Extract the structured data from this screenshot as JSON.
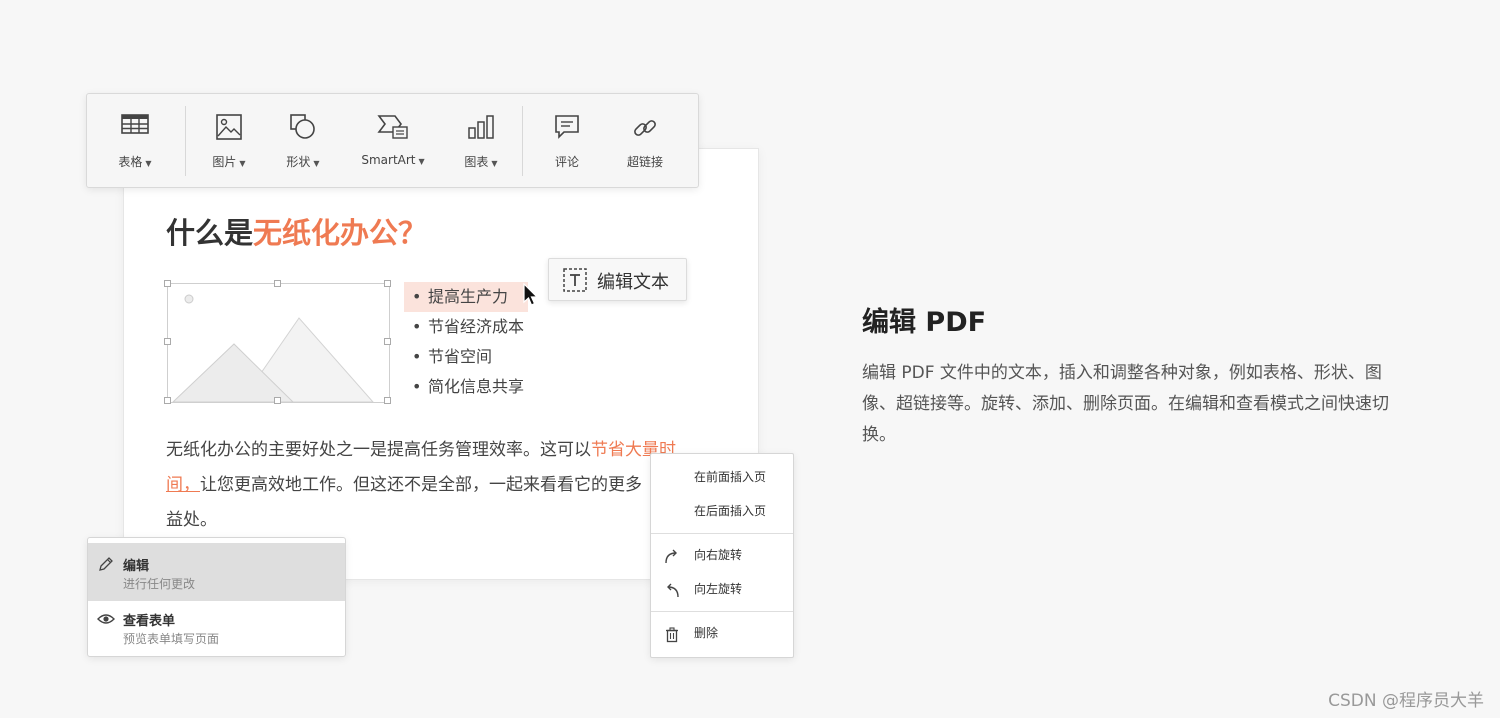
{
  "toolbar": {
    "items": [
      {
        "label": "表格",
        "has_dropdown": true,
        "icon": "table-icon"
      },
      {
        "label": "图片",
        "has_dropdown": true,
        "icon": "image-icon"
      },
      {
        "label": "形状",
        "has_dropdown": true,
        "icon": "shape-icon"
      },
      {
        "label": "SmartArt",
        "has_dropdown": true,
        "icon": "smartart-icon"
      },
      {
        "label": "图表",
        "has_dropdown": true,
        "icon": "chart-icon"
      },
      {
        "label": "评论",
        "has_dropdown": false,
        "icon": "comment-icon"
      },
      {
        "label": "超链接",
        "has_dropdown": false,
        "icon": "link-icon"
      }
    ]
  },
  "document": {
    "heading_prefix": "什么是",
    "heading_highlight": "无纸化办公？",
    "bullets": [
      "提高生产力",
      "节省经济成本",
      "节省空间",
      "简化信息共享"
    ],
    "edit_text_tooltip": "编辑文本",
    "paragraph": {
      "part1": "无纸化办公的主要好处之一是提高任务管理效率。这可以",
      "highlight1": "节省大量时",
      "highlight2": "间，",
      "part2": "让您更高效地工作。但这还不是全部，一起来看看它的更多",
      "part3": "益处。"
    }
  },
  "mode_menu": {
    "items": [
      {
        "title": "编辑",
        "subtitle": "进行任何更改",
        "icon": "pencil-icon",
        "selected": true
      },
      {
        "title": "查看表单",
        "subtitle": "预览表单填写页面",
        "icon": "eye-icon",
        "selected": false
      }
    ]
  },
  "context_menu": {
    "insert_before": "在前面插入页",
    "insert_after": "在后面插入页",
    "rotate_right": "向右旋转",
    "rotate_left": "向左旋转",
    "delete": "删除"
  },
  "feature": {
    "title": "编辑 PDF",
    "description": "编辑 PDF 文件中的文本，插入和调整各种对象，例如表格、形状、图像、超链接等。旋转、添加、删除页面。在编辑和查看模式之间快速切换。"
  },
  "watermark": "CSDN @程序员大羊",
  "colors": {
    "accent": "#ef7a52",
    "highlight_bg": "#fbe3dc",
    "background": "#f7f7f7"
  }
}
